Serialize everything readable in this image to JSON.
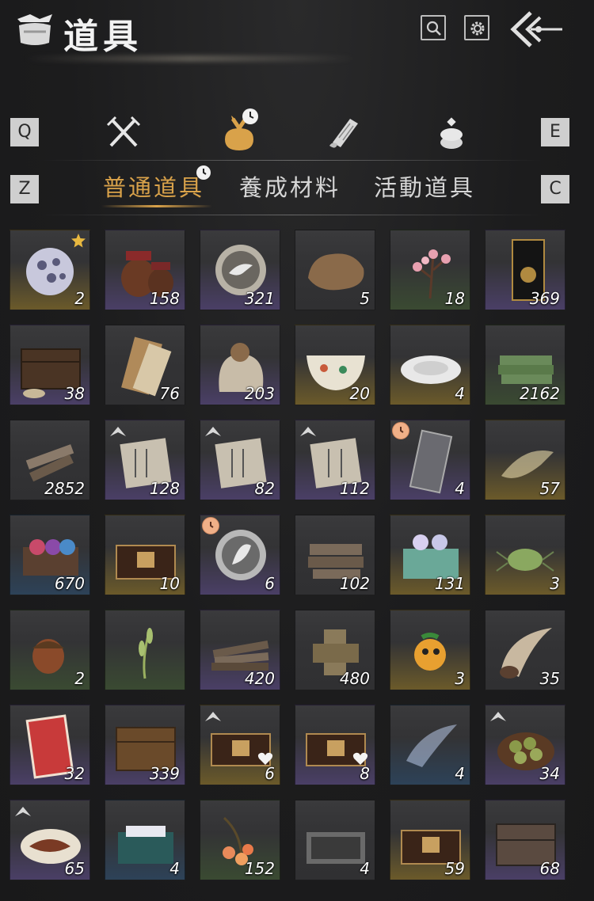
{
  "header": {
    "title": "道具",
    "search_icon": "search-icon",
    "settings_icon": "gear-icon",
    "back_icon": "back-arrow-icon"
  },
  "categories": {
    "prev_key": "Q",
    "next_key": "E",
    "items": [
      {
        "name": "weapons",
        "icon": "crossed-swords-icon",
        "active": false
      },
      {
        "name": "items",
        "icon": "bundle-icon",
        "active": true,
        "has_timer": true
      },
      {
        "name": "scrolls",
        "icon": "scroll-icon",
        "active": false
      },
      {
        "name": "currency",
        "icon": "coin-stack-icon",
        "active": false
      }
    ]
  },
  "subtabs": {
    "prev_key": "Z",
    "next_key": "C",
    "items": [
      {
        "label": "普通道具",
        "active": true,
        "has_timer": true
      },
      {
        "label": "養成材料",
        "active": false
      },
      {
        "label": "活動道具",
        "active": false
      }
    ]
  },
  "quality_colors": {
    "gold": "#6b5a2a",
    "purple": "#4a3f66",
    "green": "#3a4a32",
    "blue": "#2d4258",
    "plain": "#303032"
  },
  "items": [
    {
      "name": "crystal-orb",
      "count": "2",
      "quality": "gold",
      "badge": "star"
    },
    {
      "name": "wine-jars",
      "count": "158",
      "quality": "purple"
    },
    {
      "name": "dove-token",
      "count": "321",
      "quality": "purple"
    },
    {
      "name": "fur-pelt",
      "count": "5",
      "quality": "plain"
    },
    {
      "name": "plum-blossom",
      "count": "18",
      "quality": "green"
    },
    {
      "name": "black-invitation",
      "count": "369",
      "quality": "purple"
    },
    {
      "name": "wooden-chest",
      "count": "38",
      "quality": "purple"
    },
    {
      "name": "paper-bundle",
      "count": "76",
      "quality": "plain"
    },
    {
      "name": "grain-sack",
      "count": "203",
      "quality": "purple"
    },
    {
      "name": "porcelain-bowl",
      "count": "20",
      "quality": "gold"
    },
    {
      "name": "porcelain-plate",
      "count": "4",
      "quality": "gold"
    },
    {
      "name": "bamboo-bundle",
      "count": "2162",
      "quality": "green"
    },
    {
      "name": "wood-scraps",
      "count": "2852",
      "quality": "plain"
    },
    {
      "name": "manual-a",
      "count": "128",
      "quality": "purple",
      "badge": "mark"
    },
    {
      "name": "manual-b",
      "count": "82",
      "quality": "purple",
      "badge": "mark"
    },
    {
      "name": "manual-c",
      "count": "112",
      "quality": "purple",
      "badge": "mark"
    },
    {
      "name": "gray-token",
      "count": "4",
      "quality": "purple",
      "badge": "clock"
    },
    {
      "name": "spirit-scroll",
      "count": "57",
      "quality": "gold"
    },
    {
      "name": "dye-box",
      "count": "670",
      "quality": "blue"
    },
    {
      "name": "lacquer-box",
      "count": "10",
      "quality": "gold"
    },
    {
      "name": "leaf-token",
      "count": "6",
      "quality": "purple",
      "badge": "clock"
    },
    {
      "name": "log-pile",
      "count": "102",
      "quality": "plain"
    },
    {
      "name": "pearl-box",
      "count": "131",
      "quality": "gold"
    },
    {
      "name": "green-beetle",
      "count": "3",
      "quality": "gold"
    },
    {
      "name": "acorn",
      "count": "2",
      "quality": "green"
    },
    {
      "name": "grass-sprig",
      "count": "",
      "quality": "green"
    },
    {
      "name": "plank-pile",
      "count": "420",
      "quality": "purple"
    },
    {
      "name": "wood-blocks",
      "count": "480",
      "quality": "plain"
    },
    {
      "name": "golden-fruit",
      "count": "3",
      "quality": "gold"
    },
    {
      "name": "horn",
      "count": "35",
      "quality": "plain"
    },
    {
      "name": "red-card",
      "count": "32",
      "quality": "purple"
    },
    {
      "name": "carved-chest",
      "count": "339",
      "quality": "purple"
    },
    {
      "name": "heart-chest-a",
      "count": "6",
      "quality": "gold",
      "badge": "mark",
      "heart": true
    },
    {
      "name": "heart-chest-b",
      "count": "8",
      "quality": "purple",
      "heart": true
    },
    {
      "name": "spirit-wisp",
      "count": "4",
      "quality": "blue"
    },
    {
      "name": "dumpling-plate",
      "count": "34",
      "quality": "purple",
      "badge": "mark"
    },
    {
      "name": "fish-plate",
      "count": "65",
      "quality": "purple",
      "badge": "mark"
    },
    {
      "name": "teal-box",
      "count": "4",
      "quality": "blue"
    },
    {
      "name": "berry-branch",
      "count": "152",
      "quality": "green"
    },
    {
      "name": "tool-case",
      "count": "4",
      "quality": "plain"
    },
    {
      "name": "lacquer-box-b",
      "count": "59",
      "quality": "gold"
    },
    {
      "name": "iron-chest",
      "count": "68",
      "quality": "purple"
    }
  ]
}
